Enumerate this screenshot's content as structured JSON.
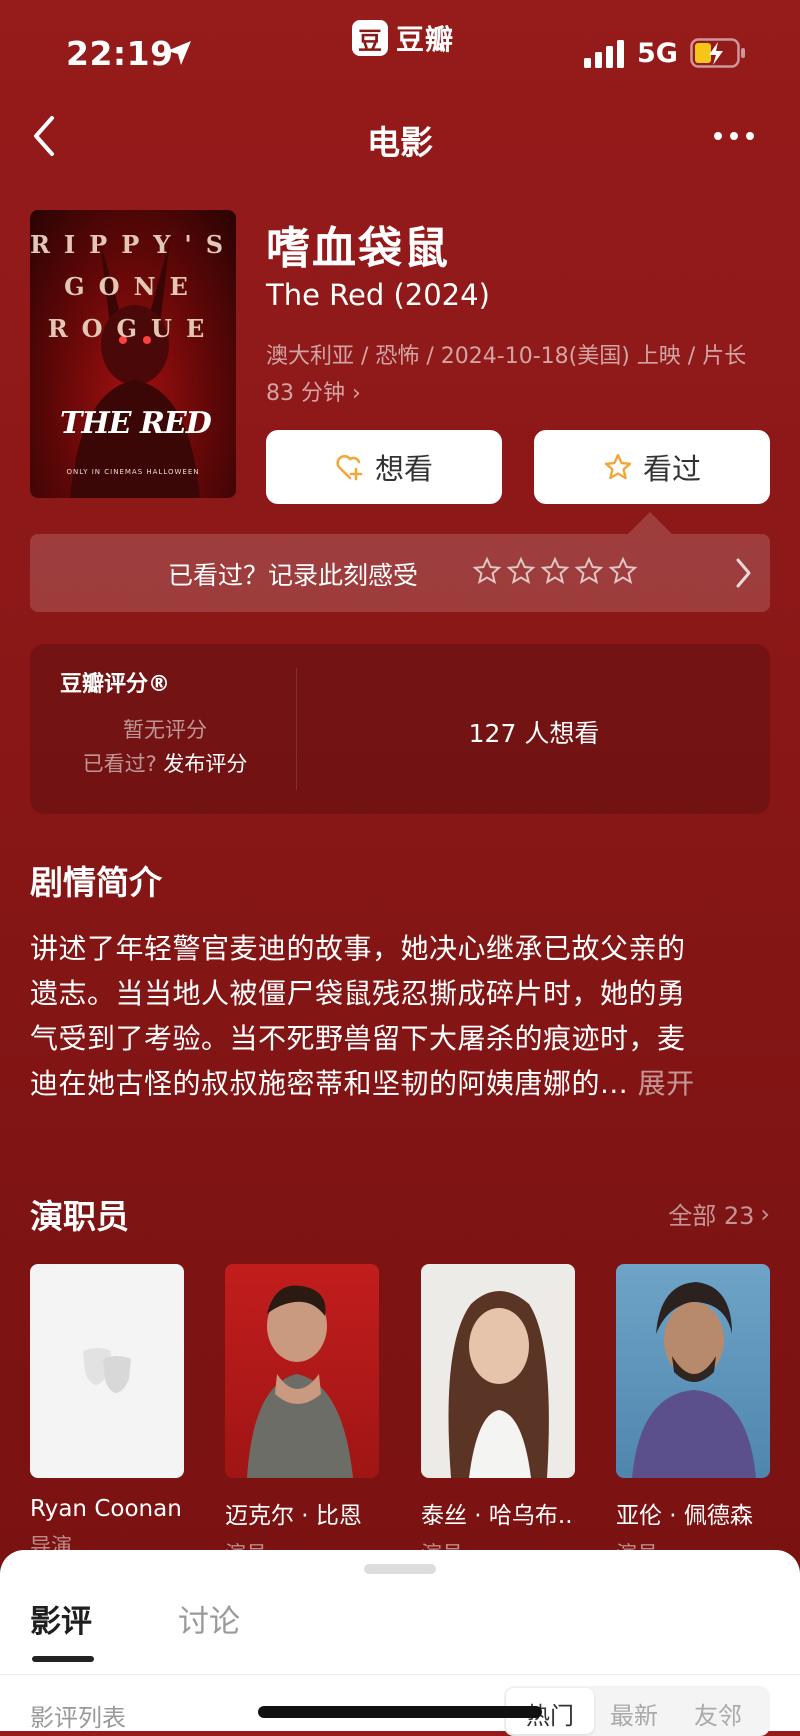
{
  "status_bar": {
    "time": "22:19",
    "app_badge": "豆",
    "app_name": "豆瓣",
    "network": "5G"
  },
  "nav": {
    "title": "电影"
  },
  "poster": {
    "line1": "RIPPY'S",
    "line2": "GONE",
    "line3": "ROGUE",
    "logo": "THE RED",
    "fineprint": "ONLY IN CINEMAS HALLOWEEN"
  },
  "movie": {
    "title": "嗜血袋鼠",
    "original_title": "The Red (2024)",
    "meta_line1": "澳大利亚 / 恐怖 / 2024-10-18(美国) 上映 / 片长",
    "meta_line2": "83 分钟"
  },
  "actions": {
    "want_label": "想看",
    "seen_label": "看过"
  },
  "record": {
    "text": "已看过？记录此刻感受",
    "star_count": 5
  },
  "rating": {
    "label": "豆瓣评分®",
    "no_rating": "暂无评分",
    "seen_prompt": "已看过?",
    "publish_link": "发布评分",
    "want_count": "127 人想看"
  },
  "synopsis": {
    "title": "剧情简介",
    "line1": "讲述了年轻警官麦迪的故事，她决心继承已故父亲的",
    "line2": "遗志。当当地人被僵尸袋鼠残忍撕成碎片时，她的勇",
    "line3": "气受到了考验。当不死野兽留下大屠杀的痕迹时，麦",
    "line4": "迪在她古怪的叔叔施密蒂和坚韧的阿姨唐娜的...",
    "expand": "展开"
  },
  "cast": {
    "title": "演职员",
    "all_label": "全部 23",
    "members": [
      {
        "name": "Ryan Coonan",
        "role": "导演"
      },
      {
        "name": "迈克尔 · 比恩",
        "role": "演员"
      },
      {
        "name": "泰丝 · 哈乌布...",
        "role": "演员"
      },
      {
        "name": "亚伦 · 佩德森",
        "role": "演员"
      }
    ]
  },
  "sheet": {
    "tabs": [
      "影评",
      "讨论"
    ],
    "list_label": "影评列表",
    "sort_options": [
      "热门",
      "最新",
      "友邻"
    ]
  },
  "colors": {
    "background": "#8a1717",
    "star_accent": "#f0a83a",
    "sheet": "#ffffff"
  }
}
